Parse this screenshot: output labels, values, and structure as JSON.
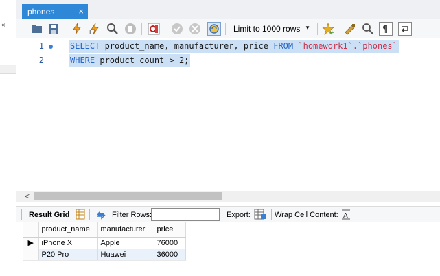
{
  "tab": {
    "title": "phones",
    "close_glyph": "×"
  },
  "toolbar": {
    "icons": [
      "folder-open-icon",
      "save-icon",
      "execute-icon",
      "execute-current-icon",
      "explain-icon",
      "stop-icon",
      "toggle-error-icon",
      "commit-icon",
      "rollback-icon",
      "autocommit-icon",
      "bookmark-icon",
      "beautify-icon",
      "find-icon",
      "invisible-chars-icon",
      "wrap-icon"
    ],
    "limit_label": "Limit to 1000 rows"
  },
  "editor": {
    "lines": [
      {
        "number": "1"
      },
      {
        "number": "2"
      }
    ],
    "line1": {
      "kw1": "SELECT",
      "text1": " product_name, manufacturer, price ",
      "kw2": "FROM",
      "text2": " ",
      "ident": "`homework1`.`phones`"
    },
    "line2": {
      "kw1": "WHERE",
      "text1": " product_count > 2;"
    }
  },
  "result_toolbar": {
    "result_grid_label": "Result Grid",
    "filter_label": "Filter Rows:",
    "filter_value": "",
    "export_label": "Export:",
    "wrap_label": "Wrap Cell Content:"
  },
  "grid": {
    "columns": [
      "product_name",
      "manufacturer",
      "price"
    ],
    "rows": [
      {
        "cells": [
          "iPhone X",
          "Apple",
          "76000"
        ],
        "current": true
      },
      {
        "cells": [
          "P20 Pro",
          "Huawei",
          "36000"
        ],
        "current": false
      }
    ]
  },
  "colors": {
    "tab_active": "#2f87d8",
    "selection": "#cce0f5",
    "keyword": "#2566c8",
    "identifier": "#c8324b"
  }
}
